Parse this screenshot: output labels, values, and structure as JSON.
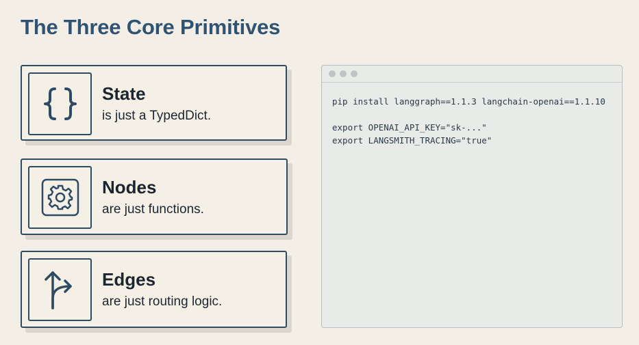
{
  "title": "The Three Core Primitives",
  "cards": [
    {
      "title": "State",
      "subtitle": "is just a TypedDict.",
      "icon": "curly-braces-icon"
    },
    {
      "title": "Nodes",
      "subtitle": "are just functions.",
      "icon": "gear-icon"
    },
    {
      "title": "Edges",
      "subtitle": "are just routing logic.",
      "icon": "split-arrow-icon"
    }
  ],
  "terminal": {
    "lines": [
      "pip install langgraph==1.1.3 langchain-openai==1.1.10",
      "",
      "export OPENAI_API_KEY=\"sk-...\"",
      "export LANGSMITH_TRACING=\"true\""
    ]
  },
  "colors": {
    "background": "#f4efe6",
    "title": "#2f5372",
    "border": "#2f4a63",
    "terminal_bg": "#e9ebe8"
  }
}
